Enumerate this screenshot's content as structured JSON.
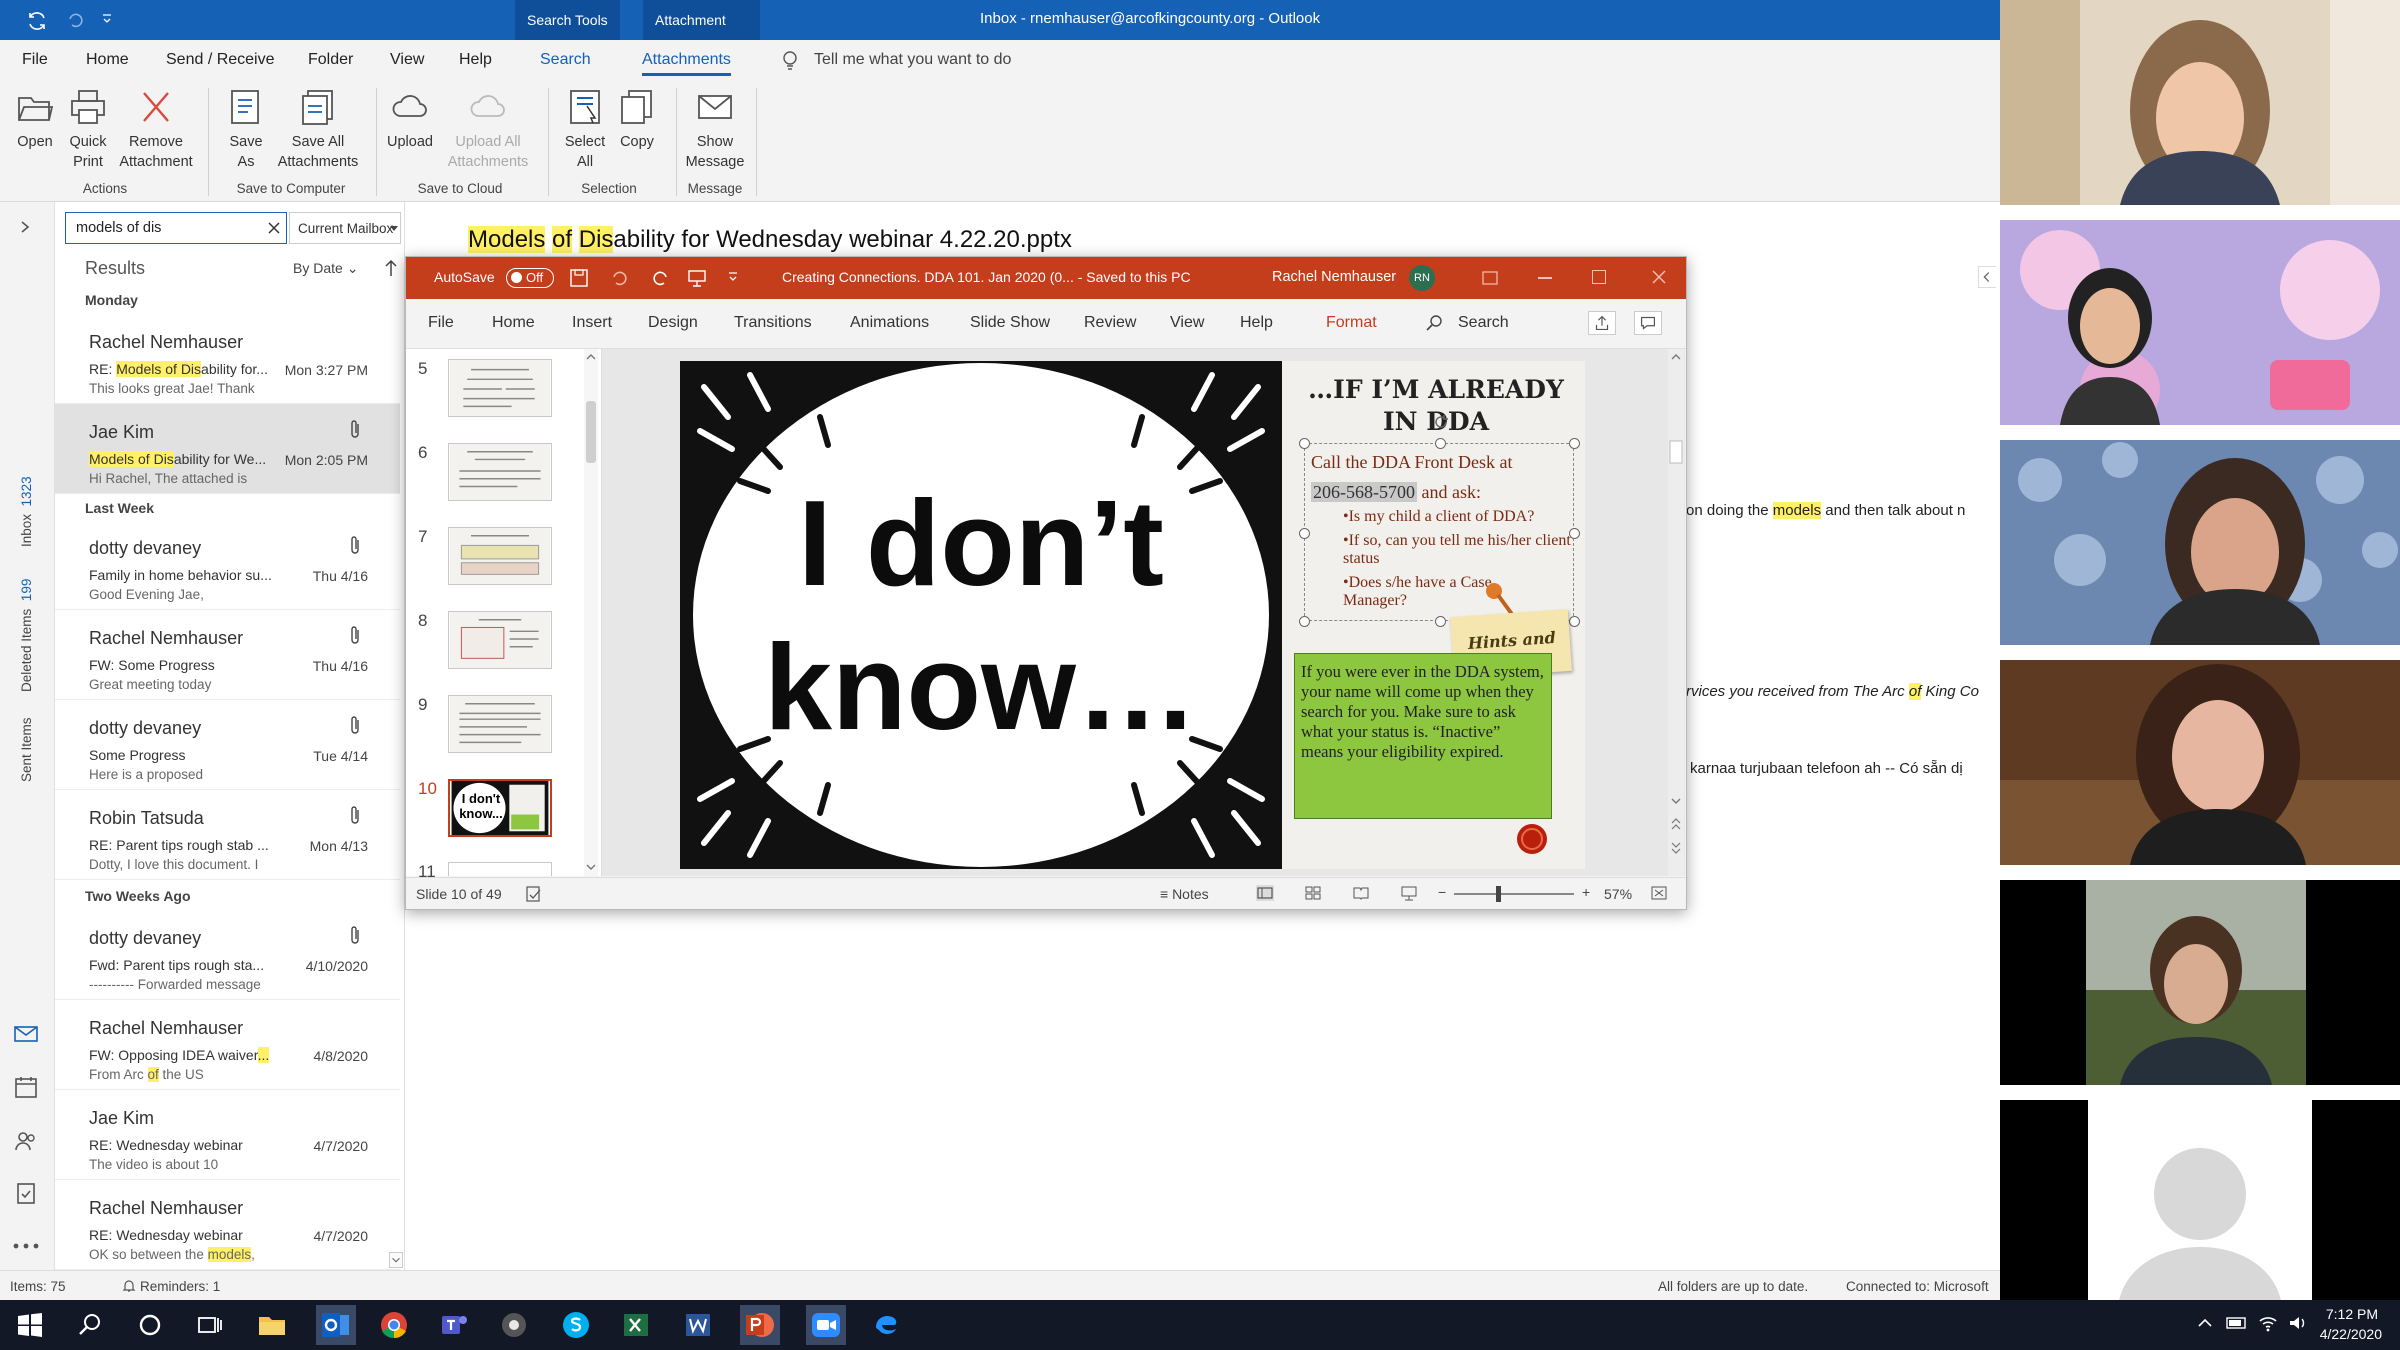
{
  "outlook": {
    "title": "Inbox - rnemhauser@arcofkingcounty.org  -  Outlook",
    "context_tabs": [
      "Search Tools",
      "Attachment Tools"
    ],
    "menu_tabs": [
      "File",
      "Home",
      "Send / Receive",
      "Folder",
      "View",
      "Help",
      "Search",
      "Attachments"
    ],
    "tell_me": "Tell me what you want to do",
    "ribbon": {
      "open": "Open",
      "quick_print": "Quick Print",
      "remove_attachment": "Remove Attachment",
      "save_as": "Save As",
      "save_all": "Save All Attachments",
      "upload": "Upload",
      "upload_all": "Upload All Attachments",
      "select_all": "Select All",
      "copy": "Copy",
      "show_message": "Show Message",
      "groups": [
        "Actions",
        "Save to Computer",
        "Save to Cloud",
        "Selection",
        "Message"
      ]
    },
    "nav": {
      "inbox": "Inbox",
      "inbox_count": "1323",
      "deleted": "Deleted Items",
      "deleted_count": "199",
      "sent": "Sent Items"
    },
    "search": {
      "value": "models of dis",
      "scope": "Current Mailbox"
    },
    "results_label": "Results",
    "sort_label": "By Date",
    "groups": {
      "monday": "Monday",
      "last_week": "Last Week",
      "two_weeks": "Two Weeks Ago"
    },
    "messages": [
      {
        "sender": "Rachel Nemhauser",
        "subject_pre": "RE: ",
        "subject_hl": "Models of Dis",
        "subject_post": "ability for...",
        "date": "Mon 3:27 PM",
        "preview": "This looks great Jae!  Thank"
      },
      {
        "sender": "Jae Kim",
        "subject_pre": "",
        "subject_hl": "Models of Dis",
        "subject_post": "ability for We...",
        "date": "Mon 2:05 PM",
        "preview": "Hi Rachel,  The attached is"
      },
      {
        "sender": "dotty devaney",
        "subject": "Family in home behavior su...",
        "date": "Thu 4/16",
        "preview": "Good Evening Jae,"
      },
      {
        "sender": "Rachel Nemhauser",
        "subject": "FW: Some Progress",
        "date": "Thu 4/16",
        "preview": "Great meeting today"
      },
      {
        "sender": "dotty devaney",
        "subject": "Some Progress",
        "date": "Tue 4/14",
        "preview": "Here is a proposed"
      },
      {
        "sender": "Robin Tatsuda",
        "subject": "RE: Parent tips rough stab ...",
        "date": "Mon 4/13",
        "preview": "Dotty, I love this document.  I"
      },
      {
        "sender": "dotty devaney",
        "subject": "Fwd: Parent tips rough sta...",
        "date": "4/10/2020",
        "preview": "---------- Forwarded message"
      },
      {
        "sender": "Rachel Nemhauser",
        "subject_pre": "FW: Opposing IDEA waiver",
        "subject_hl": "...",
        "subject_post": "",
        "date": "4/8/2020",
        "preview_pre": "From Arc ",
        "preview_hl": "of",
        "preview_post": " the US"
      },
      {
        "sender": "Jae Kim",
        "subject": "RE: Wednesday webinar",
        "date": "4/7/2020",
        "preview": "The video is about 10"
      },
      {
        "sender": "Rachel Nemhauser",
        "subject": "RE: Wednesday webinar",
        "date": "4/7/2020",
        "preview_pre": "OK so between the ",
        "preview_hl": "models",
        "preview_post": ","
      }
    ],
    "attachment": {
      "hl1": "Models",
      "mid1": " ",
      "hl2": "of",
      "mid2": " ",
      "hl3": "Dis",
      "rest": "ability for Wednesday webinar 4.22.20.pptx"
    },
    "body_snippets": {
      "s1_pre": "on doing the ",
      "s1_hl": "models",
      "s1_post": " and then talk about n",
      "s2_pre": "rvices you received from The Arc ",
      "s2_hl": "of",
      "s2_post": " King Co",
      "s3": "karnaa turjubaan telefoon ah -- Có sẵn dị"
    },
    "statusbar": {
      "items": "Items: 75",
      "reminders": "Reminders: 1",
      "folders": "All folders are up to date.",
      "connected": "Connected to: Microsoft"
    }
  },
  "powerpoint": {
    "autosave": "AutoSave",
    "autosave_state": "Off",
    "doc_title": "Creating Connections. DDA 101. Jan 2020 (0...  -  Saved to this PC",
    "user": "Rachel Nemhauser",
    "initials": "RN",
    "tabs": [
      "File",
      "Home",
      "Insert",
      "Design",
      "Transitions",
      "Animations",
      "Slide Show",
      "Review",
      "View",
      "Help",
      "Format"
    ],
    "search": "Search",
    "slide_numbers": [
      "5",
      "6",
      "7",
      "8",
      "9",
      "10",
      "11"
    ],
    "current_slide": "10",
    "status": "Slide 10 of 49",
    "notes": "Notes",
    "zoom": "57%",
    "slide": {
      "big_text_1": "I don’t",
      "big_text_2": "know…",
      "heading_1": "…IF I’M ALREADY",
      "heading_2": "IN DDA",
      "call_pre": "Call the DDA Front Desk at",
      "phone": "206-568-5700",
      "call_post": " and ask:",
      "bullet_1": "•Is my child a client of DDA?",
      "bullet_2": "•If so, can you tell me his/her client status",
      "bullet_3": "•Does s/he have a Case Manager?",
      "tips_label": "Hints and Tips",
      "green_text": "If you were ever in the DDA system, your name will come up when they search for you.  Make sure to ask what your status is. “Inactive” means your eligibility expired.",
      "thumb_text": "I don't know..."
    }
  },
  "taskbar": {
    "time": "7:12 PM",
    "date": "4/22/2020"
  },
  "colors": {
    "outlook_blue": "#1561b6",
    "ppt_orange": "#c43e1c",
    "highlight": "#fff066",
    "tips_green": "#8dc63f"
  }
}
